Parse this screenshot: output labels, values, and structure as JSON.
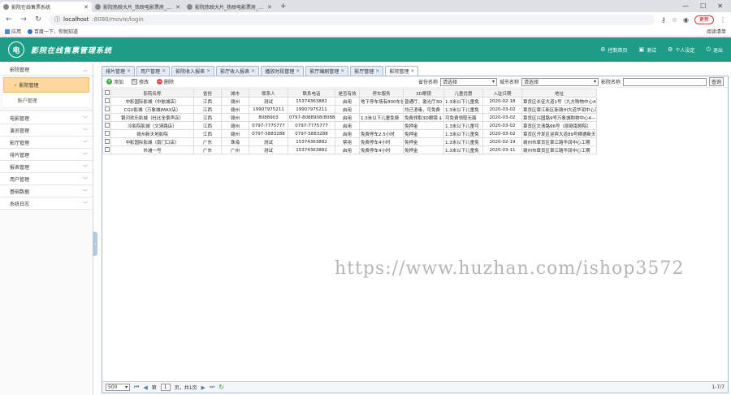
{
  "browser": {
    "tabs": [
      {
        "title": "影院在线售票系统",
        "active": true
      },
      {
        "title": "影院热映大片_热映电影票房_影院",
        "active": false
      },
      {
        "title": "影院热映大片_热映电影票房_影院",
        "active": false
      }
    ],
    "url_host": "localhost",
    "url_path": ":8080/movie/login",
    "update_label": "更新",
    "bookmarks": [
      {
        "label": "应用"
      },
      {
        "label": "百度一下，你就知道"
      }
    ],
    "reading_list": "阅读清单"
  },
  "header": {
    "logo_char": "电",
    "title": "影院在线售票管理系统",
    "links": [
      {
        "label": "控制首页",
        "icon": "gear-icon"
      },
      {
        "label": "测试",
        "icon": "user-icon"
      },
      {
        "label": "个人设定",
        "icon": "settings-icon"
      },
      {
        "label": "退出",
        "icon": "logout-icon"
      }
    ]
  },
  "sidebar": {
    "groups": [
      {
        "label": "影院管理",
        "expanded": true,
        "items": [
          {
            "label": "影院管理",
            "active": true
          },
          {
            "label": "账户管理",
            "active": false
          }
        ]
      },
      {
        "label": "电影管理"
      },
      {
        "label": "演员管理"
      },
      {
        "label": "影厅管理"
      },
      {
        "label": "排片管理"
      },
      {
        "label": "报表管理"
      },
      {
        "label": "用户管理"
      },
      {
        "label": "基础数据"
      },
      {
        "label": "系统日志"
      }
    ]
  },
  "tabs": [
    {
      "label": "排片管理"
    },
    {
      "label": "用户管理"
    },
    {
      "label": "影院收入报表"
    },
    {
      "label": "影厅收入报表"
    },
    {
      "label": "播放时段管理"
    },
    {
      "label": "影厅编剧管理"
    },
    {
      "label": "影厅管理"
    },
    {
      "label": "影院管理",
      "active": true
    }
  ],
  "actions": {
    "add": "添加",
    "edit": "修改",
    "delete": "删除"
  },
  "filters": {
    "province_label": "省份名称",
    "province_value": "请选择",
    "city_label": "城市名称",
    "city_value": "请选择",
    "cinema_label": "影院名称",
    "cinema_value": "",
    "search_button": "查询"
  },
  "table": {
    "columns": [
      "影院名称",
      "省份",
      "城市",
      "联系人",
      "联系电话",
      "是否有效",
      "停车服务",
      "3D眼镜",
      "儿童优惠",
      "入驻日期",
      "地址"
    ],
    "rows": [
      [
        "中影国际影城（中航城店）",
        "江西",
        "赣州",
        "测试",
        "15374363882",
        "启用",
        "地下停车场有800车位",
        "普通厅、激光厅3D",
        "1.3米以下儿童免",
        "2020-02-18",
        "章贡区长征大道1号（九方购物中心4楼"
      ],
      [
        "CGV影城（万象城IMAX店）",
        "江西",
        "赣州",
        "19907975211",
        "19907975211",
        "启用",
        "",
        "均已消毒，可免费",
        "1.3米以下儿童免",
        "2020-03-02",
        "章贡区章江新区新赣州大道华润中心万"
      ],
      [
        "银河欢乐影城（杜比全景声店）",
        "江西",
        "赣州",
        "8088903",
        "0797-8088908/8088",
        "启用",
        "1.3米以下儿童免费",
        "免费领取3D眼镜 $",
        "可免费领取无面",
        "2020-03-02",
        "章贡区兴国路9号万象城购物中心4—F"
      ],
      [
        "冷影院影城（文清路店）",
        "江西",
        "赣州",
        "0797-7775777",
        "0797-7775777",
        "启用",
        "",
        "免押金",
        "1.3米以下儿童可",
        "2020-03-02",
        "章贡区文清路66号（原赣南剧院）"
      ],
      [
        "赣州新天地影院",
        "江西",
        "赣州",
        "0797-5883288",
        "0797-5883288",
        "启用",
        "免费停车2.5小时",
        "免押金",
        "1.3米以下儿童免",
        "2020-03-02",
        "章贡区开发区迎宾大道89号横德新天"
      ],
      [
        "中影国际影城（南门口店）",
        "广东",
        "珠海",
        "测试",
        "15374363882",
        "禁用",
        "免费停车4小时",
        "免押金",
        "1.3米以下儿童免",
        "2020-02-19",
        "赣州市章贡区章江路华润中心工期"
      ],
      [
        "外滩一号",
        "广东",
        "广州",
        "测试",
        "15374363882",
        "启用",
        "免费停车4小时",
        "免押金",
        "1.3米以下儿童免",
        "2020-03-11",
        "赣州市章贡区章江路华润中心工期"
      ]
    ]
  },
  "pager": {
    "page_size": "500",
    "page_prefix": "第",
    "page_number": "1",
    "page_suffix": "页，共1页",
    "count": "1-7/7"
  },
  "watermark": "https://www.huzhan.com/ishop3572"
}
